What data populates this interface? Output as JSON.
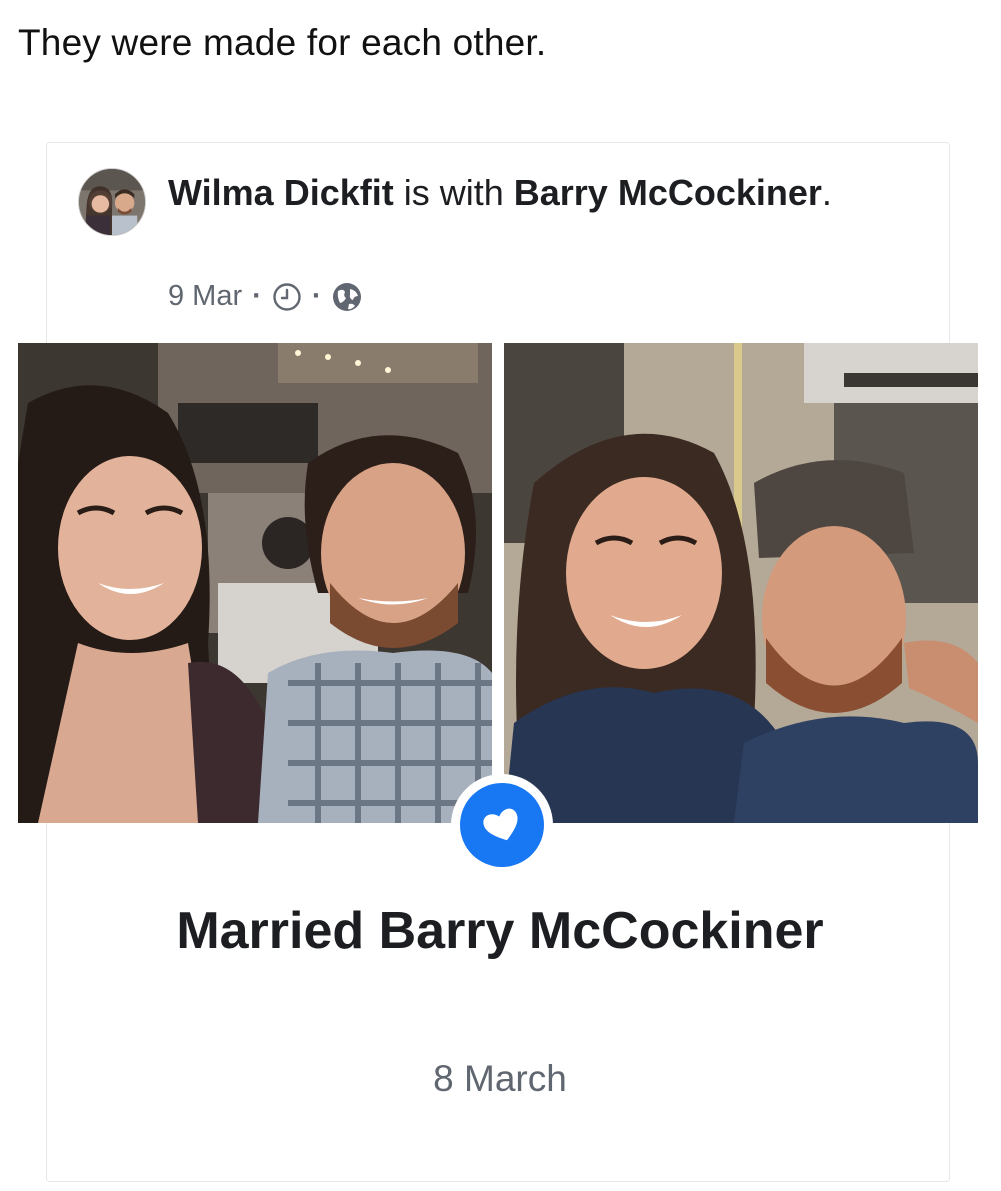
{
  "caption": "They were made for each other.",
  "post": {
    "author_name": "Wilma Dickfit",
    "with_text": " is with ",
    "tagged_name": "Barry McCockiner",
    "end_period": ".",
    "date": "9 Mar",
    "separator": "·",
    "icons": [
      "clock-icon",
      "globe-icon"
    ]
  },
  "life_event": {
    "badge_icon": "heart-icon",
    "title": "Married Barry McCockiner",
    "date": "8 March"
  },
  "colors": {
    "accent_blue": "#1877f2",
    "text_primary": "#1c1e21",
    "text_secondary": "#606770"
  }
}
